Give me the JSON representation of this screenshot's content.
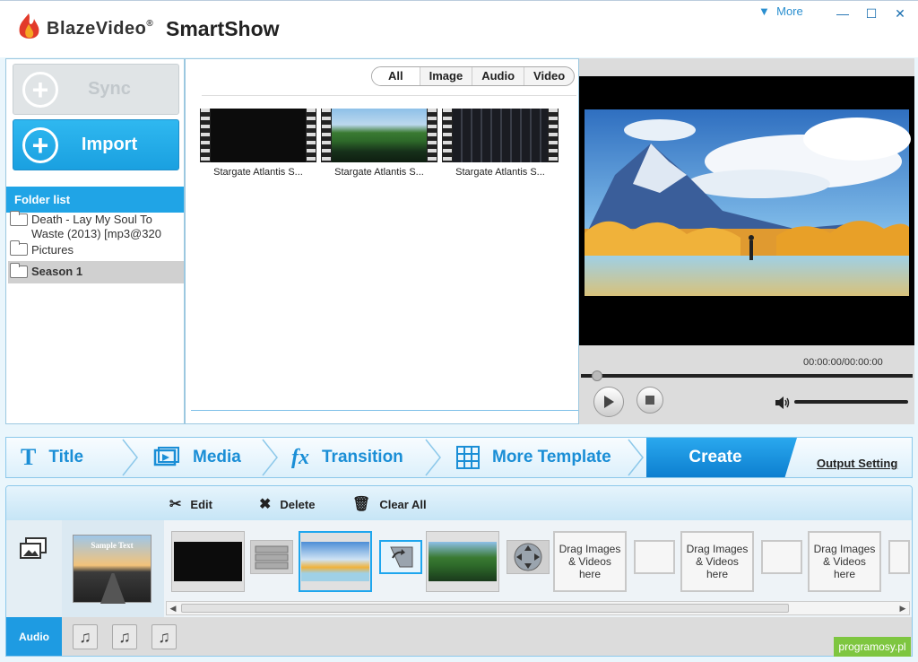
{
  "app": {
    "brand": "BlazeVideo",
    "brand_reg": "®",
    "name": "SmartShow",
    "more_label": "More"
  },
  "window_controls": {
    "minimize": "—",
    "maximize": "☐",
    "close": "✕"
  },
  "left_panel": {
    "sync_label": "Sync",
    "import_label": "Import",
    "folder_list_header": "Folder list",
    "folders": [
      {
        "label": "Death - Lay My Soul To Waste (2013) [mp3@320",
        "selected": false
      },
      {
        "label": "Pictures",
        "selected": false
      },
      {
        "label": "Season 1",
        "selected": true
      }
    ]
  },
  "media_browser": {
    "filter_tabs": [
      "All",
      "Image",
      "Audio",
      "Video"
    ],
    "active_filter": "All",
    "items": [
      {
        "caption": "Stargate Atlantis S..."
      },
      {
        "caption": "Stargate Atlantis S..."
      },
      {
        "caption": "Stargate Atlantis S..."
      }
    ]
  },
  "preview": {
    "time_readout": "00:00:00/00:00:00",
    "seek_progress": 0.0
  },
  "steps": {
    "title_label": "Title",
    "media_label": "Media",
    "transition_label": "Transition",
    "more_template_label": "More Template",
    "create_label": "Create",
    "output_setting_label": "Output Setting"
  },
  "storyboard": {
    "edit_label": "Edit",
    "delete_label": "Delete",
    "clear_all_label": "Clear All",
    "title_thumb_text": "Sample Text",
    "drop_hint": "Drag Images & Videos here",
    "audio_label": "Audio",
    "audio_slots": 3
  },
  "watermark": "programosy.pl",
  "colors": {
    "accent": "#1ea6ee",
    "brand_red": "#e23a2a"
  }
}
